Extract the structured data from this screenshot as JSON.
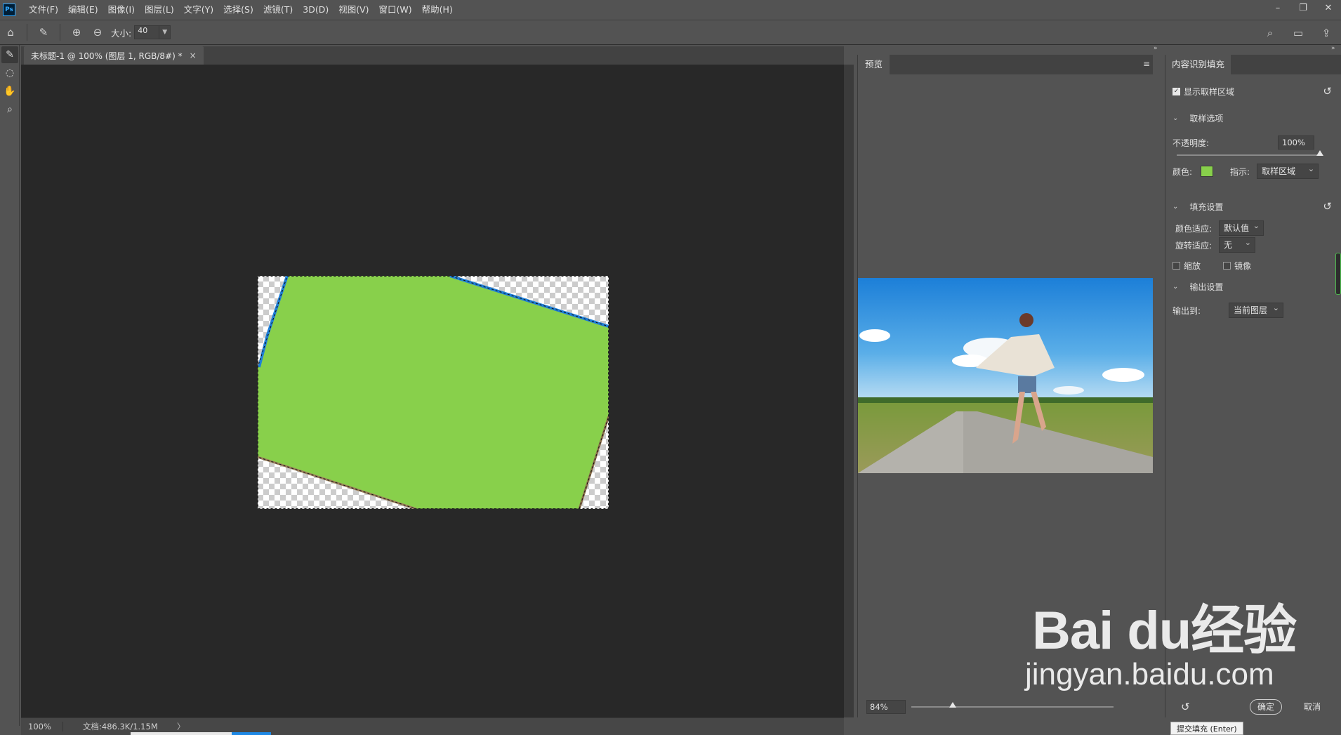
{
  "app": {
    "logo": "Ps",
    "menu": [
      "文件(F)",
      "编辑(E)",
      "图像(I)",
      "图层(L)",
      "文字(Y)",
      "选择(S)",
      "滤镜(T)",
      "3D(D)",
      "视图(V)",
      "窗口(W)",
      "帮助(H)"
    ]
  },
  "options": {
    "size_label": "大小:",
    "size_value": "40"
  },
  "document": {
    "tab_title": "未标题-1 @ 100% (图层 1, RGB/8#) *",
    "sample_color": "#88d04b"
  },
  "status": {
    "zoom": "100%",
    "doc_info": "文档:486.3K/1.15M",
    "arrow": "〉"
  },
  "preview": {
    "tab": "预览",
    "zoom": "84%"
  },
  "caf": {
    "tab": "内容识别填充",
    "show_sampling": "显示取样区域",
    "sampling_options": "取样选项",
    "opacity_label": "不透明度:",
    "opacity_value": "100%",
    "color_label": "颜色:",
    "indicate_label": "指示:",
    "indicate_value": "取样区域",
    "fill_settings": "填充设置",
    "color_adapt_label": "颜色适应:",
    "color_adapt_value": "默认值",
    "rotate_adapt_label": "旋转适应:",
    "rotate_adapt_value": "无",
    "scale_label": "缩放",
    "mirror_label": "镜像",
    "output_settings": "输出设置",
    "output_label": "输出到:",
    "output_value": "当前图层",
    "ok": "确定",
    "cancel": "取消",
    "tooltip": "提交填充 (Enter)"
  },
  "watermark": {
    "logo": "Bai du经验",
    "url": "jingyan.baidu.com"
  }
}
